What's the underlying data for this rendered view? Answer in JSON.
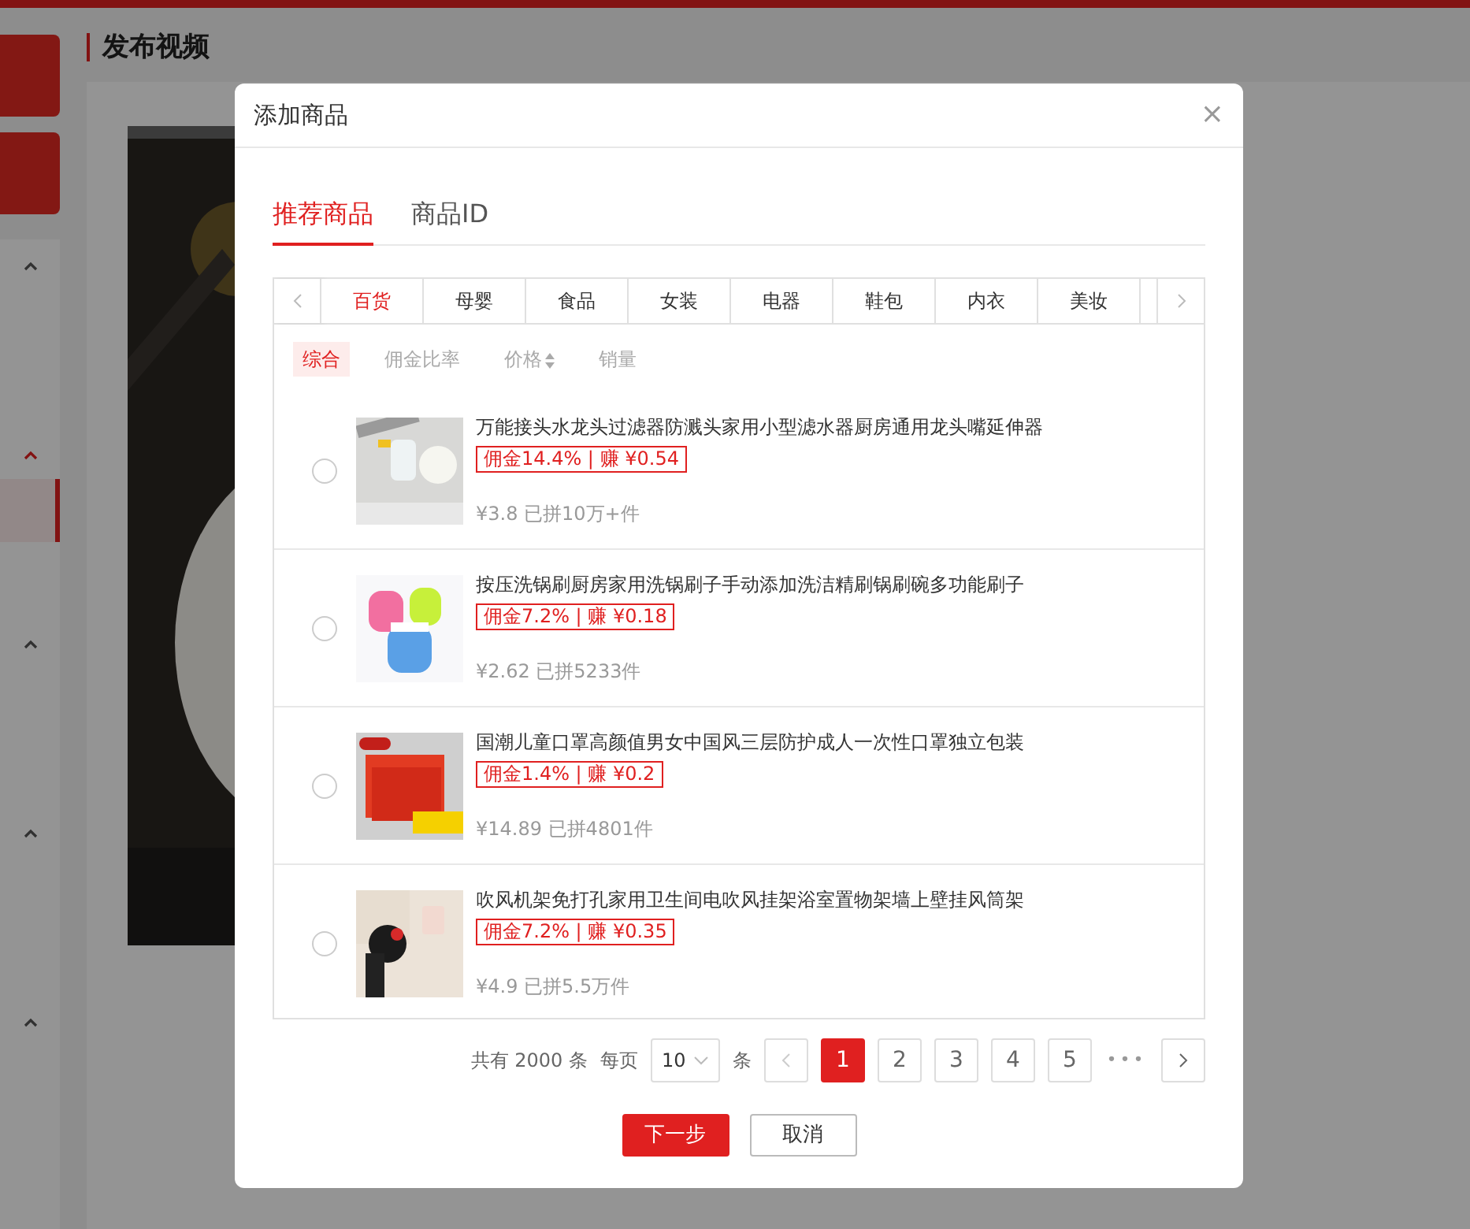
{
  "page": {
    "title": "发布视频",
    "sidebar": {
      "items": [
        {
          "selected": false
        },
        {
          "selected": true
        },
        {
          "selected": false
        },
        {
          "selected": false
        },
        {
          "selected": false
        }
      ]
    }
  },
  "dialog": {
    "title": "添加商品",
    "close": "×",
    "tabs": [
      {
        "label": "推荐商品",
        "selected": true
      },
      {
        "label": "商品ID",
        "selected": false
      }
    ],
    "categories": [
      {
        "label": "百货",
        "selected": true
      },
      {
        "label": "母婴",
        "selected": false
      },
      {
        "label": "食品",
        "selected": false
      },
      {
        "label": "女装",
        "selected": false
      },
      {
        "label": "电器",
        "selected": false
      },
      {
        "label": "鞋包",
        "selected": false
      },
      {
        "label": "内衣",
        "selected": false
      },
      {
        "label": "美妆",
        "selected": false
      }
    ],
    "sort_options": [
      {
        "label": "综合",
        "selected": true,
        "sortable": false
      },
      {
        "label": "佣金比率",
        "selected": false,
        "sortable": false
      },
      {
        "label": "价格",
        "selected": false,
        "sortable": true
      },
      {
        "label": "销量",
        "selected": false,
        "sortable": false
      }
    ],
    "products": [
      {
        "title": "万能接头水龙头过滤器防溅头家用小型滤水器厨房通用龙头嘴延伸器",
        "commission": "佣金14.4% | 赚 ¥0.54",
        "price_sales": "¥3.8 已拼10万+件",
        "selected": false
      },
      {
        "title": "按压洗锅刷厨房家用洗锅刷子手动添加洗洁精刷锅刷碗多功能刷子",
        "commission": "佣金7.2% | 赚 ¥0.18",
        "price_sales": "¥2.62 已拼5233件",
        "selected": false
      },
      {
        "title": "国潮儿童口罩高颜值男女中国风三层防护成人一次性口罩独立包装",
        "commission": "佣金1.4% | 赚 ¥0.2",
        "price_sales": "¥14.89 已拼4801件",
        "selected": false
      },
      {
        "title": "吹风机架免打孔家用卫生间电吹风挂架浴室置物架墙上壁挂风筒架",
        "commission": "佣金7.2% | 赚 ¥0.35",
        "price_sales": "¥4.9 已拼5.5万件",
        "selected": false
      }
    ],
    "pagination": {
      "total": "共有 2000 条",
      "per_page_label": "每页",
      "per_page": "10",
      "unit": "条",
      "pages": [
        {
          "label": "1",
          "selected": true
        },
        {
          "label": "2",
          "selected": false
        },
        {
          "label": "3",
          "selected": false
        },
        {
          "label": "4",
          "selected": false
        },
        {
          "label": "5",
          "selected": false
        }
      ],
      "ellipsis": "•••"
    },
    "buttons": [
      {
        "label": "下一步",
        "kind": "primary"
      },
      {
        "label": "取消",
        "kind": "secondary"
      }
    ]
  }
}
